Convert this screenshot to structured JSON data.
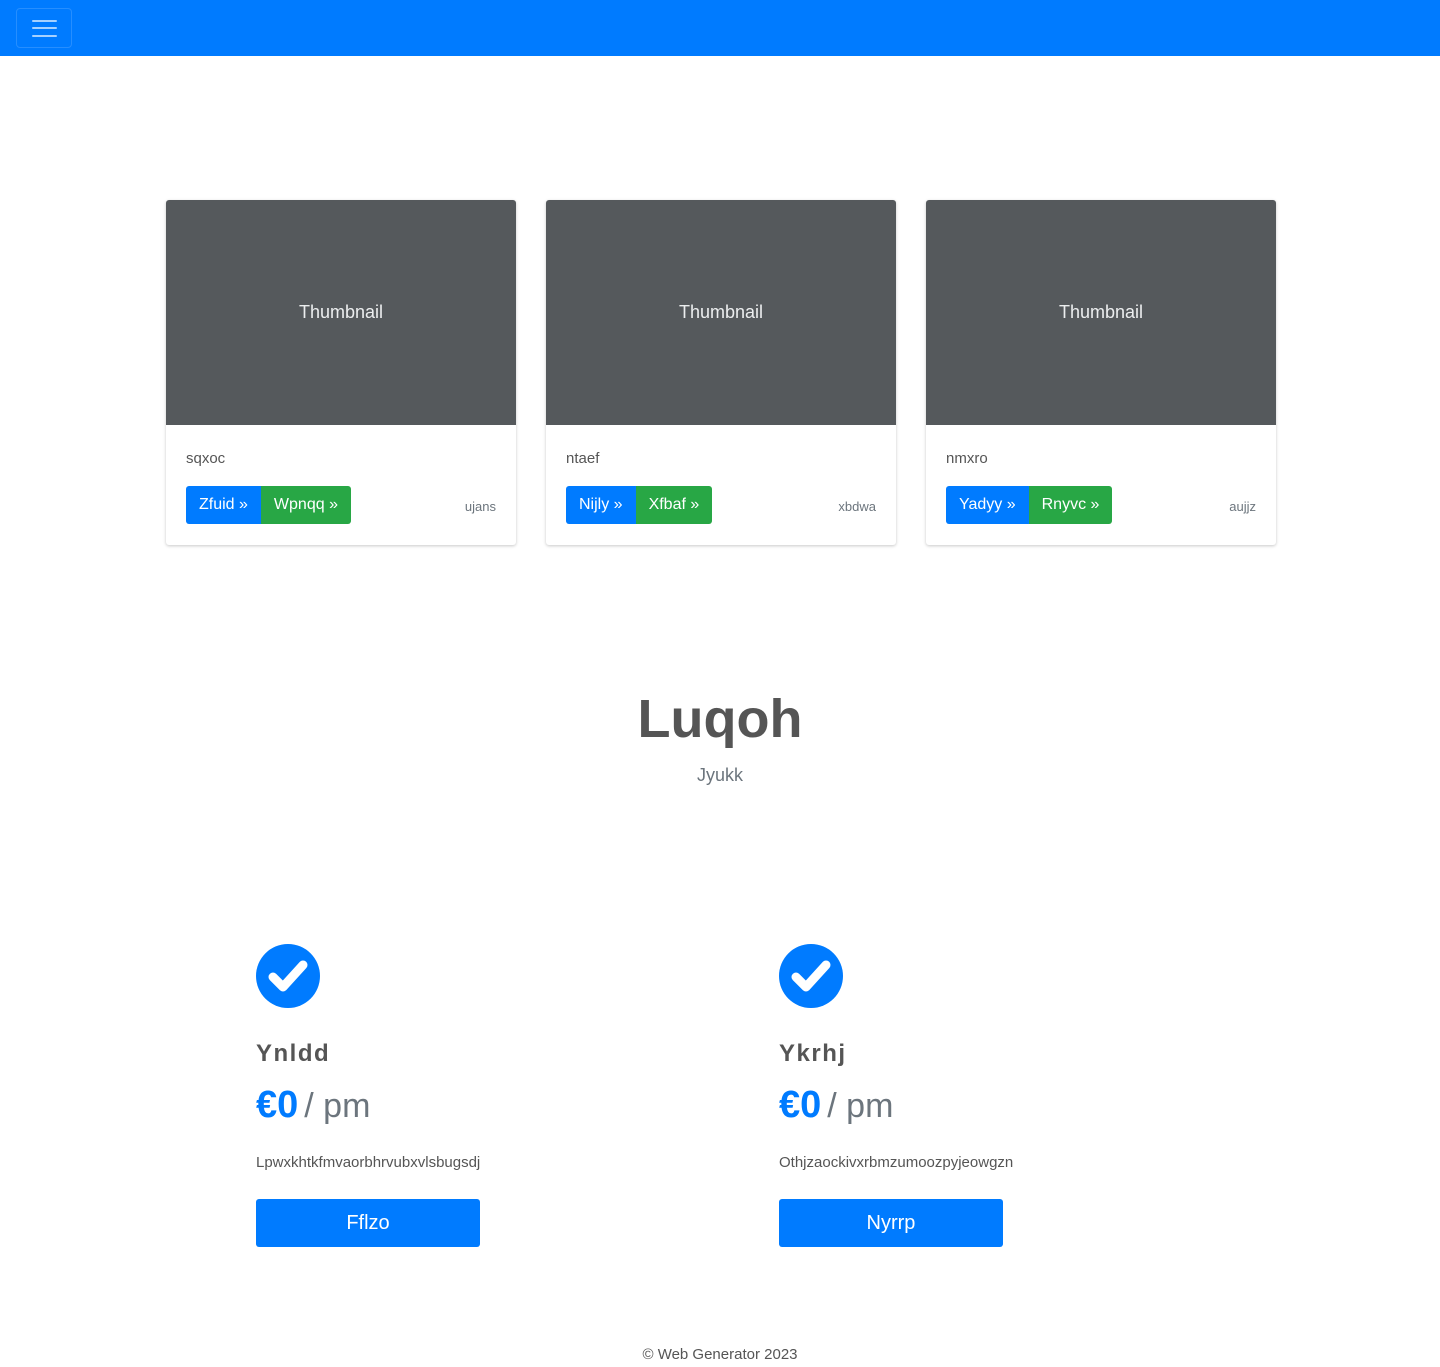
{
  "navbar": {
    "toggler_icon": "hamburger-icon",
    "accent": "#007bff"
  },
  "cards": [
    {
      "thumbnail": "Thumbnail",
      "text": "sqxoc",
      "primary_button": "Zfuid »",
      "secondary_button": "Wpnqq »",
      "muted": "ujans"
    },
    {
      "thumbnail": "Thumbnail",
      "text": "ntaef",
      "primary_button": "Nijly »",
      "secondary_button": "Xfbaf »",
      "muted": "xbdwa"
    },
    {
      "thumbnail": "Thumbnail",
      "text": "nmxro",
      "primary_button": "Yadyy »",
      "secondary_button": "Rnyvc »",
      "muted": "aujjz"
    }
  ],
  "hero": {
    "title": "Luqoh",
    "subtitle": "Jyukk"
  },
  "features": [
    {
      "icon": "check-circle-icon",
      "title": "Ynldd",
      "price": "€0",
      "period": "/ pm",
      "description": "Lpwxkhtkfmvaorbhrvubxvlsbugsdj",
      "button": "Fflzo"
    },
    {
      "icon": "check-circle-icon",
      "title": "Ykrhj",
      "price": "€0",
      "period": "/ pm",
      "description": "Othjzaockivxrbmzumoozpyjeowgzn",
      "button": "Nyrrp"
    }
  ],
  "footer": {
    "text": "© Web Generator 2023"
  },
  "colors": {
    "primary": "#007bff",
    "success": "#28a745",
    "thumbnail": "#55595c"
  }
}
